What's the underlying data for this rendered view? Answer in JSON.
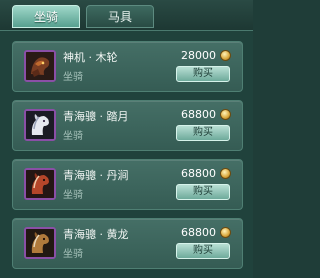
{
  "tabs": {
    "active_label": "坐骑",
    "inactive_label": "马具"
  },
  "items": [
    {
      "name": "神机 · 木轮",
      "type": "坐骑",
      "price": "28000",
      "buy_label": "购买",
      "icon": "dark-mech-mount-icon"
    },
    {
      "name": "青海骢 · 踏月",
      "type": "坐骑",
      "price": "68800",
      "buy_label": "购买",
      "icon": "white-horse-icon"
    },
    {
      "name": "青海骢 · 丹涧",
      "type": "坐骑",
      "price": "68800",
      "buy_label": "购买",
      "icon": "red-horse-icon"
    },
    {
      "name": "青海骢 · 黄龙",
      "type": "坐骑",
      "price": "68800",
      "buy_label": "购买",
      "icon": "brown-horse-icon"
    }
  ],
  "colors": {
    "panel": "#20423c",
    "card": "#456f66",
    "accent": "#9fd7c9",
    "icon_border": "#8a4fa6",
    "coin": "#d9a73c"
  }
}
